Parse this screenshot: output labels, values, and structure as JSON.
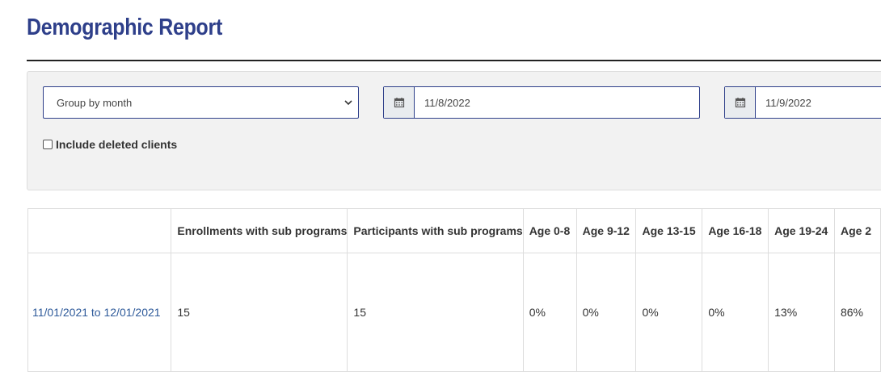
{
  "page": {
    "title": "Demographic Report"
  },
  "filters": {
    "group_by": "Group by month",
    "date_from": "11/8/2022",
    "date_to": "11/9/2022",
    "include_deleted_label": "Include deleted clients"
  },
  "table": {
    "headers": [
      "",
      "Enrollments with sub programs",
      "Participants with sub programs",
      "Age 0-8",
      "Age 9-12",
      "Age 13-15",
      "Age 16-18",
      "Age 19-24",
      "Age 2"
    ],
    "rows": [
      {
        "period": "11/01/2021 to 12/01/2021",
        "cells": [
          "15",
          "15",
          "0%",
          "0%",
          "0%",
          "0%",
          "13%",
          "86%"
        ]
      }
    ]
  }
}
